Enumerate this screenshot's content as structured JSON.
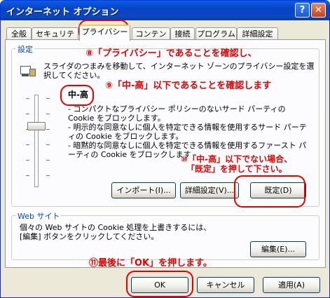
{
  "window": {
    "title": "インターネット オプション",
    "help": "?",
    "close": "✕"
  },
  "tabs": [
    "全般",
    "セキュリティ",
    "プライバシー",
    "コンテンツ",
    "接続",
    "プログラム",
    "詳細設定"
  ],
  "settings": {
    "label": "設定",
    "description": "スライダのつまみを移動して、インターネット ゾーンのプライバシー設定を選択してください。",
    "level": "中-高",
    "bullets": [
      "- コンパクトなプライバシー ポリシーのないサード パーティの Cookie をブロックします。",
      "- 明示的な同意なしに個人を特定できる情報を使用するサード パーティの Cookie をブロックします。",
      "- 暗黙的な同意なしに個人を特定できる情報を使用するファースト パーティの Cookie をブロックします"
    ],
    "import_button": "インポート(I)...",
    "advanced_button": "詳細設定(V)...",
    "default_button": "既定(D)"
  },
  "website": {
    "label": "Web サイト",
    "description_line1": "個々の Web サイトの Cookie 処理を上書きするには、",
    "description_line2": "[編集] ボタンをクリックしてください。",
    "edit_button": "編集(E)..."
  },
  "footer": {
    "ok": "OK",
    "cancel": "キャンセル",
    "apply": "適用(A)"
  },
  "annotations": {
    "a8": "⑧「プライバシー」であることを確認し、",
    "a9": "⑨「中-高」以下であることを確認します",
    "a10_line1": "⑩「中-高」以下でない場合、",
    "a10_line2": "「既定」を押して下さい。",
    "a11": "⑪最後に「OK」を押します。"
  },
  "colors": {
    "annotation": "#e60000",
    "title_bar": "#0a5fe8"
  }
}
